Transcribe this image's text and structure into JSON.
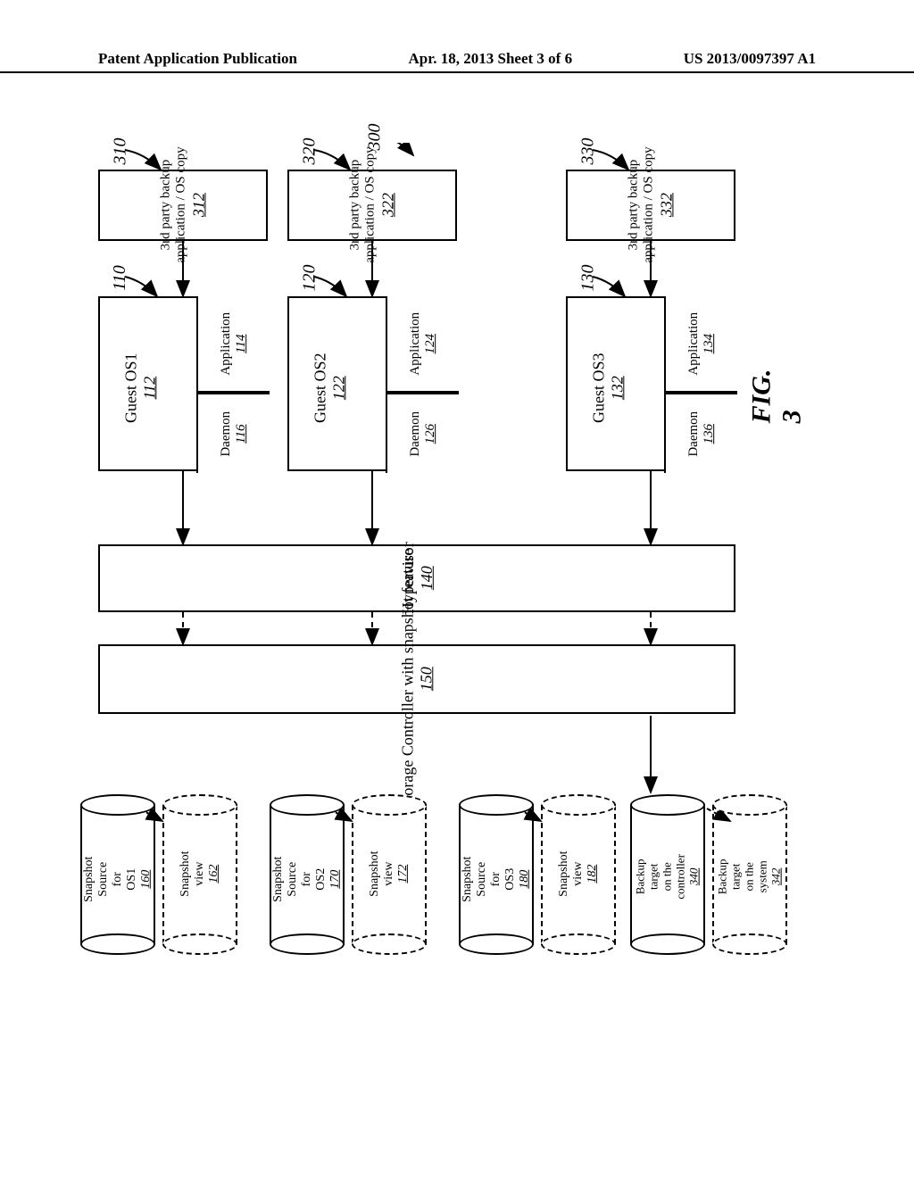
{
  "header": {
    "left": "Patent Application Publication",
    "center": "Apr. 18, 2013  Sheet 3 of 6",
    "right": "US 2013/0097397 A1"
  },
  "refs": {
    "r300": "300",
    "r310": "310",
    "r320": "320",
    "r330": "330",
    "r110": "110",
    "r120": "120",
    "r130": "130"
  },
  "figure_label": "FIG. 3",
  "backup_app": {
    "title": "3rd party backup application / OS copy",
    "n312": "312",
    "n322": "322",
    "n332": "332"
  },
  "guest_os": {
    "os1": "Guest OS1",
    "os1_n": "112",
    "os2": "Guest OS2",
    "os2_n": "122",
    "os3": "Guest OS3",
    "os3_n": "132"
  },
  "app": {
    "label": "Application",
    "n114": "114",
    "n124": "124",
    "n134": "134"
  },
  "daemon": {
    "label": "Daemon",
    "n116": "116",
    "n126": "126",
    "n136": "136"
  },
  "hypervisor": {
    "label": "Hypervisor",
    "n": "140"
  },
  "controller": {
    "label": "Storage Controller with snapshot feature",
    "n": "150"
  },
  "cylinders": {
    "src_os1": {
      "l1": "Snapshot",
      "l2": "Source",
      "l3": "for",
      "l4": "OS1",
      "n": "160"
    },
    "view1": {
      "l1": "Snapshot",
      "l2": "view",
      "n": "162"
    },
    "src_os2": {
      "l1": "Snapshot",
      "l2": "Source",
      "l3": "for",
      "l4": "OS2",
      "n": "170"
    },
    "view2": {
      "l1": "Snapshot",
      "l2": "view",
      "n": "172"
    },
    "src_os3": {
      "l1": "Snapshot",
      "l2": "Source",
      "l3": "for",
      "l4": "OS3",
      "n": "180"
    },
    "view3": {
      "l1": "Snapshot",
      "l2": "view",
      "n": "182"
    },
    "bkp_ctrl": {
      "l1": "Backup",
      "l2": "target",
      "l3": "on the",
      "l4": "controller",
      "n": "340"
    },
    "bkp_sys": {
      "l1": "Backup",
      "l2": "target",
      "l3": "on the",
      "l4": "system",
      "n": "342"
    }
  }
}
